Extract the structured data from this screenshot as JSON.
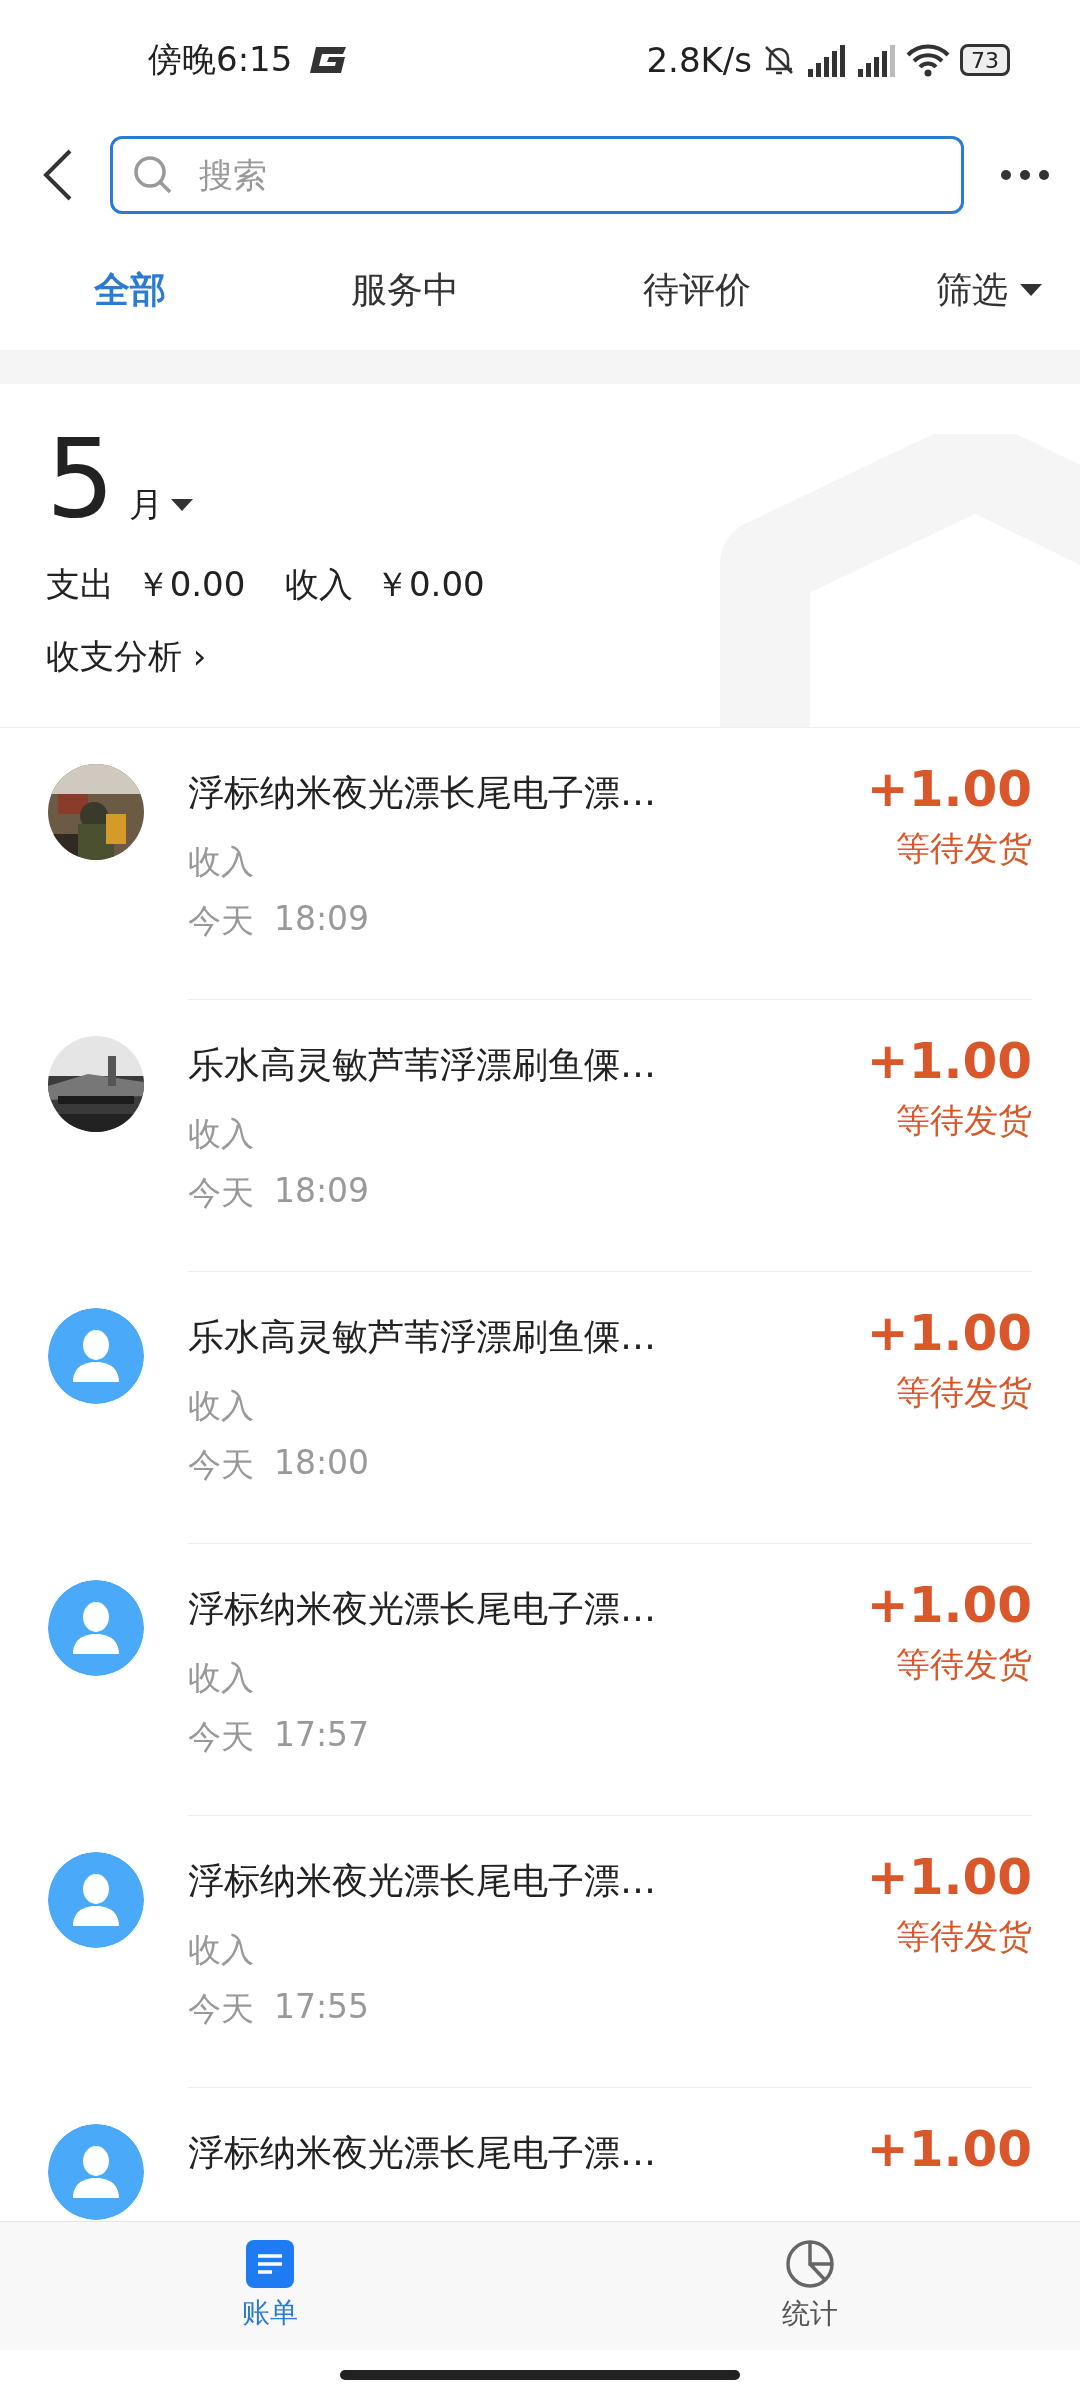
{
  "status_bar": {
    "time": "傍晚6:15",
    "speed": "2.8K/s",
    "battery": "73"
  },
  "header": {
    "search": {
      "placeholder": "搜索"
    }
  },
  "tabs": [
    {
      "label": "全部",
      "selected": true,
      "kind": "plain"
    },
    {
      "label": "服务中",
      "selected": false,
      "kind": "plain"
    },
    {
      "label": "待评价",
      "selected": false,
      "kind": "plain"
    },
    {
      "label": "筛选",
      "selected": false,
      "kind": "dropdown"
    }
  ],
  "summary": {
    "month": "5",
    "month_unit": "月",
    "expense_label": "支出",
    "expense": "￥0.00",
    "income_label": "收入",
    "income": "￥0.00",
    "analysis_link": "收支分析 ›"
  },
  "transactions": [
    {
      "title": "浮标纳米夜光漂长尾电子漂…",
      "type": "收入",
      "date": "今天",
      "time": "18:09",
      "amount": "+1.00",
      "status": "等待发货"
    },
    {
      "title": "乐水高灵敏芦苇浮漂刷鱼傈…",
      "type": "收入",
      "date": "今天",
      "time": "18:09",
      "amount": "+1.00",
      "status": "等待发货"
    },
    {
      "avatar": {
        "kind": "default"
      },
      "title": "乐水高灵敏芦苇浮漂刷鱼傈…",
      "type": "收入",
      "date": "今天",
      "time": "18:00",
      "amount": "+1.00",
      "status": "等待发货"
    },
    {
      "avatar": {
        "kind": "default"
      },
      "title": "浮标纳米夜光漂长尾电子漂…",
      "type": "收入",
      "date": "今天",
      "time": "17:57",
      "amount": "+1.00",
      "status": "等待发货"
    },
    {
      "avatar": {
        "kind": "default"
      },
      "title": "浮标纳米夜光漂长尾电子漂…",
      "type": "收入",
      "date": "今天",
      "time": "17:55",
      "amount": "+1.00",
      "status": "等待发货"
    },
    {
      "avatar": {
        "kind": "default"
      },
      "title": "浮标纳米夜光漂长尾电子漂…",
      "amount": "+1.00"
    }
  ],
  "bottom_nav": [
    {
      "label": "账单",
      "selected": true,
      "kind": "bill"
    },
    {
      "label": "统计",
      "selected": false,
      "kind": "stats"
    }
  ]
}
